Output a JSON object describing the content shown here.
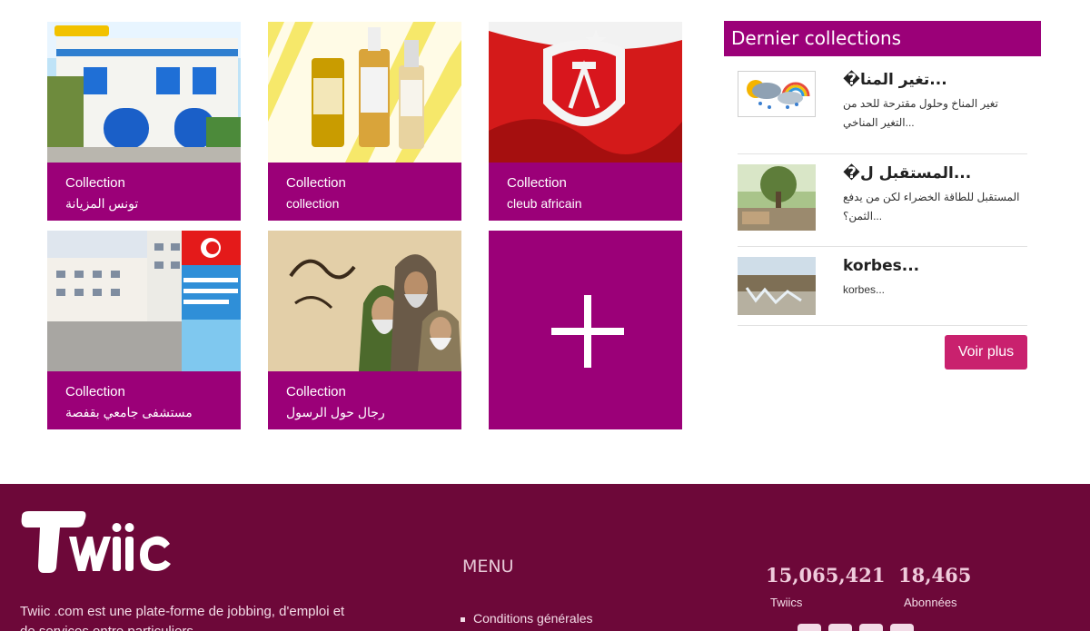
{
  "collections": [
    {
      "type": "Collection",
      "name": "تونس المزيانة"
    },
    {
      "type": "Collection",
      "name": "collection"
    },
    {
      "type": "Collection",
      "name": "cleub africain"
    },
    {
      "type": "Collection",
      "name": "مستشفى جامعي بقفصة"
    },
    {
      "type": "Collection",
      "name": "رجال حول الرسول"
    }
  ],
  "add_icon": "plus-icon",
  "sidebar": {
    "title": "Dernier collections",
    "entries": [
      {
        "title": "�تغير المنا...",
        "desc": "تغير المناخ وحلول مقترحة للحد من التغير المناخي..."
      },
      {
        "title": "�المستقبل ل...",
        "desc": "المستقبل للطاقة الخضراء لكن من يدفع الثمن؟..."
      },
      {
        "title": "korbes...",
        "desc": "korbes..."
      }
    ],
    "voir_plus": "Voir plus"
  },
  "footer": {
    "logo_text": "Twiic",
    "about": "Twiic .com est une plate-forme de jobbing, d'emploi et de services entre particuliers",
    "menu_title": "MENU",
    "menu_items": [
      "Conditions générales"
    ],
    "stats": [
      {
        "value": "15,065,421",
        "label": "Twiics"
      },
      {
        "value": "18,465",
        "label": "Abonnées"
      }
    ],
    "social_icons": [
      "facebook-icon",
      "instagram-icon",
      "twitter-icon",
      "linkedin-icon"
    ]
  },
  "colors": {
    "accent": "#9b0078",
    "button": "#c9216e",
    "footer": "#6d0839"
  }
}
